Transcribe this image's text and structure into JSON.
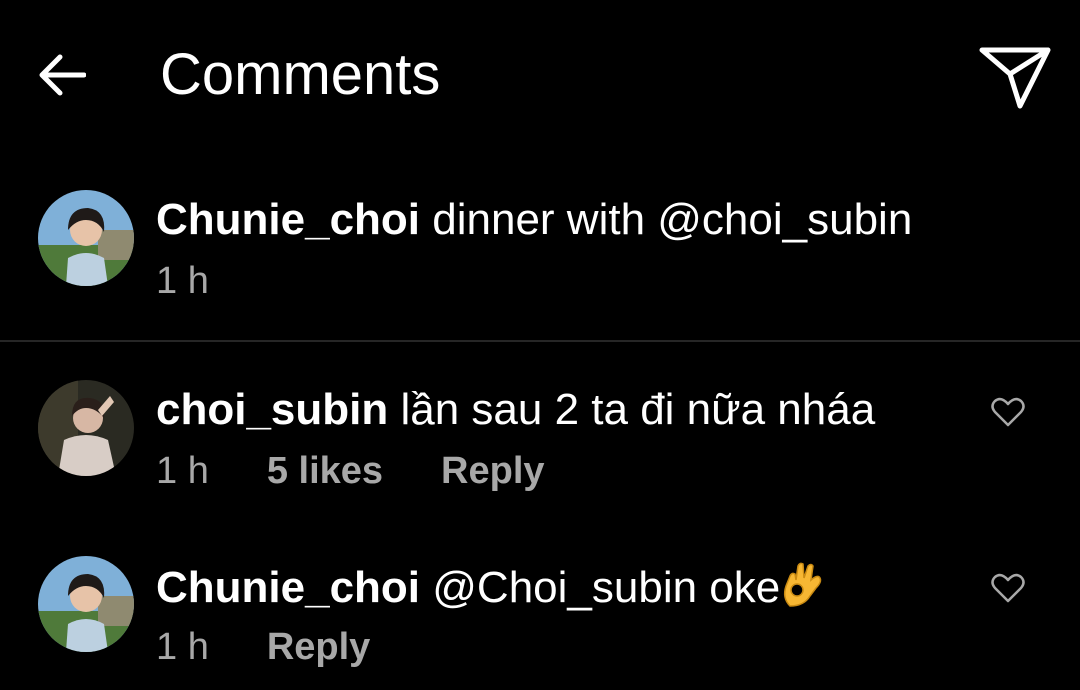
{
  "header": {
    "title": "Comments"
  },
  "caption": {
    "username": "Chunie_choi",
    "text": " dinner with @choi_subin",
    "time": "1 h"
  },
  "comments": [
    {
      "username": "choi_subin",
      "text": " lần sau 2 ta đi nữa nháa",
      "time": "1 h",
      "likes": "5 likes",
      "reply": "Reply"
    },
    {
      "username": "Chunie_choi",
      "text": " @Choi_subin oke",
      "time": "1 h",
      "reply": "Reply"
    }
  ],
  "colors": {
    "background": "#000000",
    "primary_text": "#ffffff",
    "secondary_text": "#a8a8a8",
    "divider": "#262626"
  },
  "icons": {
    "back": "back-arrow-icon",
    "share": "paper-plane-icon",
    "like": "heart-outline-icon",
    "emoji": "ok-hand-emoji"
  }
}
